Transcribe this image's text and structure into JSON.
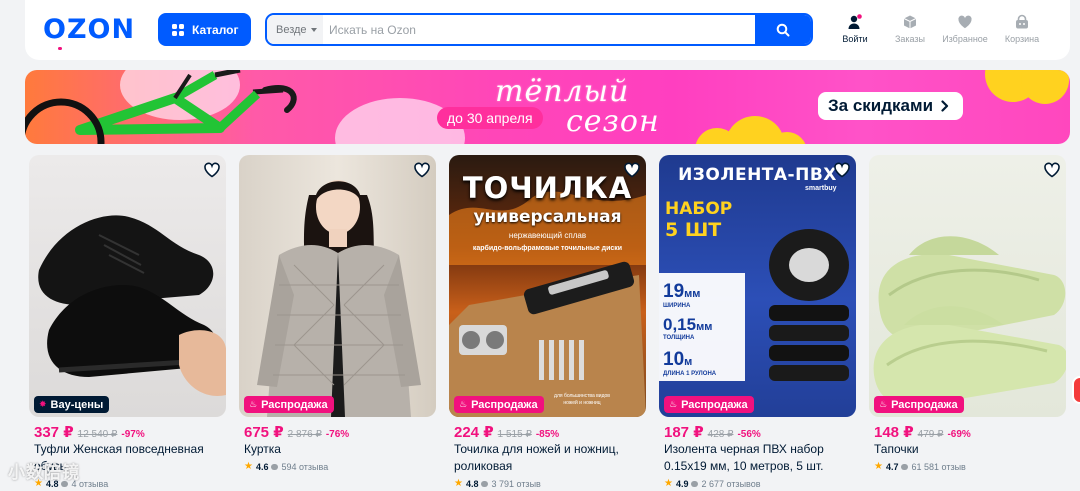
{
  "header": {
    "logo": "OZON",
    "catalog_label": "Каталог",
    "search": {
      "scope": "Везде",
      "placeholder": "Искать на Ozon"
    },
    "nav": [
      {
        "label": "Войти",
        "icon": "user-icon"
      },
      {
        "label": "Заказы",
        "icon": "box-icon"
      },
      {
        "label": "Избранное",
        "icon": "heart-icon"
      },
      {
        "label": "Корзина",
        "icon": "cart-icon"
      }
    ]
  },
  "banner": {
    "title": "тёплый",
    "subtitle": "сезон",
    "date": "до 30 апреля",
    "cta": "За скидками",
    "colors": {
      "accent": "#ff3fc0",
      "flower": "#ffd21f"
    }
  },
  "products": [
    {
      "badge": "Вау-цены",
      "badge_type": "bay",
      "price": "337 ₽",
      "old_price": "12 540 ₽",
      "discount": "-97%",
      "title": "Туфли Женская повседневная обувь",
      "rating": "4.8",
      "reviews": "4 отзыва",
      "image": "black-sneakers"
    },
    {
      "badge": "Распродажа",
      "badge_type": "sale",
      "price": "675 ₽",
      "old_price": "2 876 ₽",
      "discount": "-76%",
      "title": "Куртка",
      "rating": "4.6",
      "reviews": "594 отзыва",
      "image": "quilted-jacket"
    },
    {
      "badge": "Распродажа",
      "badge_type": "sale",
      "price": "224 ₽",
      "old_price": "1 515 ₽",
      "discount": "-85%",
      "title": "Точилка для ножей и ножниц, роликовая",
      "rating": "4.8",
      "reviews": "3 791 отзыв",
      "image": "knife-sharpener",
      "image_text": {
        "line1": "ТОЧИЛКА",
        "line2": "универсальная",
        "line3": "нержавеющий сплав",
        "line4": "карбидо-вольфрамовые точильные диски",
        "line5": "для большинства видов ножей и ножниц"
      }
    },
    {
      "badge": "Распродажа",
      "badge_type": "sale",
      "price": "187 ₽",
      "old_price": "428 ₽",
      "discount": "-56%",
      "title": "Изолента черная ПВХ набор 0.15х19 мм, 10 метров, 5 шт.",
      "rating": "4.9",
      "reviews": "2 677 отзывов",
      "image": "insulating-tape",
      "image_text": {
        "heading": "ИЗОЛЕНТА-ПВХ",
        "set": "НАБОР",
        "count": "5 ШТ",
        "brand": "smartbuy",
        "width_val": "19",
        "width_unit": "мм",
        "width_label": "ШИРИНА",
        "thick_val": "0,15",
        "thick_unit": "мм",
        "thick_label": "ТОЛЩИНА",
        "len_val": "10",
        "len_unit": "м",
        "len_label": "ДЛИНА 1 РУЛОНА"
      }
    },
    {
      "badge": "Распродажа",
      "badge_type": "sale",
      "price": "148 ₽",
      "old_price": "479 ₽",
      "discount": "-69%",
      "title": "Тапочки",
      "rating": "4.7",
      "reviews": "61 581 отзыв",
      "image": "green-slippers"
    }
  ],
  "watermark": "小数陪镜"
}
